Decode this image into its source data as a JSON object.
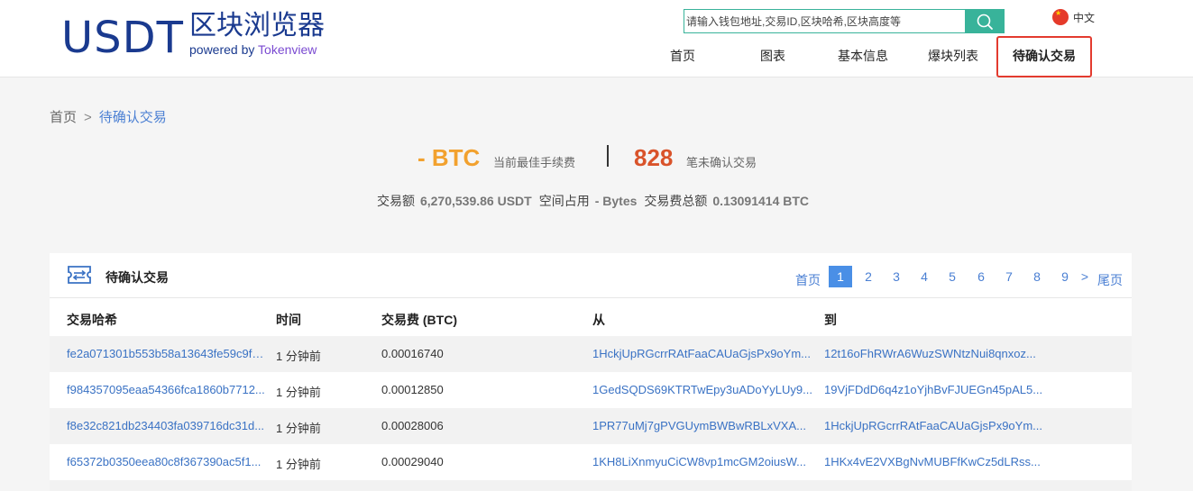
{
  "logo": {
    "main": "USDT",
    "cn": "区块浏览器",
    "powered": "powered by",
    "brand": "Tokenview"
  },
  "search": {
    "placeholder": "请输入钱包地址,交易ID,区块哈希,区块高度等",
    "value": ""
  },
  "language": "中文",
  "nav": [
    "首页",
    "图表",
    "基本信息",
    "爆块列表",
    "待确认交易"
  ],
  "nav_active": "待确认交易",
  "breadcrumb": {
    "home": "首页",
    "sep": ">",
    "current": "待确认交易"
  },
  "stats": {
    "fee_value": "- BTC",
    "fee_label": "当前最佳手续费",
    "count_value": "828",
    "count_label": "笔未确认交易"
  },
  "summary": {
    "amount_label": "交易额",
    "amount_value": "6,270,539.86 USDT",
    "space_label": "空间占用",
    "space_value": "- Bytes",
    "fee_total_label": "交易费总额",
    "fee_total_value": "0.13091414 BTC"
  },
  "card": {
    "title": "待确认交易"
  },
  "pager": {
    "first": "首页",
    "pages": [
      "1",
      "2",
      "3",
      "4",
      "5",
      "6",
      "7",
      "8",
      "9"
    ],
    "active": "1",
    "next": ">",
    "last": "尾页"
  },
  "table": {
    "headers": [
      "交易哈希",
      "时间",
      "交易费 (BTC)",
      "从",
      "到"
    ],
    "rows": [
      {
        "hash": "fe2a071301b553b58a13643fe59c9fc...",
        "time": "1 分钟前",
        "fee": "0.00016740",
        "from": "1HckjUpRGcrrRAtFaaCAUaGjsPx9oYm...",
        "to": "12t16oFhRWrA6WuzSWNtzNui8qnxoz..."
      },
      {
        "hash": "f984357095eaa54366fca1860b7712...",
        "time": "1 分钟前",
        "fee": "0.00012850",
        "from": "1GedSQDS69KTRTwEpy3uADoYyLUy9...",
        "to": "19VjFDdD6q4z1oYjhBvFJUEGn45pAL5..."
      },
      {
        "hash": "f8e32c821db234403fa039716dc31d...",
        "time": "1 分钟前",
        "fee": "0.00028006",
        "from": "1PR77uMj7gPVGUymBWBwRBLxVXA...",
        "to": "1HckjUpRGcrrRAtFaaCAUaGjsPx9oYm..."
      },
      {
        "hash": "f65372b0350eea80c8f367390ac5f1...",
        "time": "1 分钟前",
        "fee": "0.00029040",
        "from": "1KH8LiXnmyuCiCW8vp1mcGM2oiusW...",
        "to": "1HKx4vE2VXBgNvMUBFfKwCz5dLRss..."
      }
    ]
  },
  "colors": {
    "brand": "#1a3a8f",
    "accent": "#38b39a",
    "link": "#3a72c4",
    "fee": "#f2a12e",
    "count": "#d9532a",
    "active_border": "#e33b2f"
  }
}
